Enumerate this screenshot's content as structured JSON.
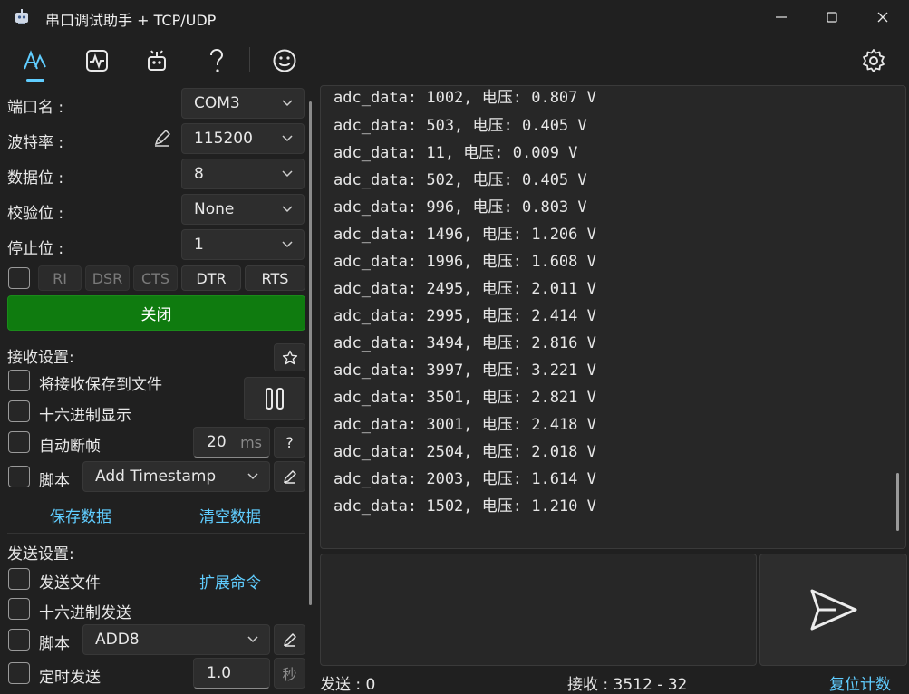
{
  "window": {
    "title": "串口调试助手 + TCP/UDP"
  },
  "toolbar": {
    "icons": [
      "waveform-text-icon",
      "pulse-chart-icon",
      "robot-icon",
      "help-icon",
      "smiley-icon",
      "settings-gear-icon"
    ]
  },
  "serial": {
    "port_label": "端口名 :",
    "port_value": "COM3",
    "baud_label": "波特率 :",
    "baud_value": "115200",
    "databits_label": "数据位 :",
    "databits_value": "8",
    "parity_label": "校验位 :",
    "parity_value": "None",
    "stopbits_label": "停止位 :",
    "stopbits_value": "1",
    "pins": [
      "RI",
      "DSR",
      "CTS",
      "DTR",
      "RTS"
    ],
    "close_button": "关闭"
  },
  "receive": {
    "section_label": "接收设置:",
    "save_to_file": "将接收保存到文件",
    "hex_display": "十六进制显示",
    "auto_frame": "自动断帧",
    "auto_frame_value": "20",
    "auto_frame_unit": "ms",
    "help_label": "?",
    "script_label": "脚本",
    "script_value": "Add Timestamp",
    "save_data": "保存数据",
    "clear_data": "清空数据"
  },
  "send": {
    "section_label": "发送设置:",
    "send_file": "发送文件",
    "ext_commands": "扩展命令",
    "hex_send": "十六进制发送",
    "script_label": "脚本",
    "script_value": "ADD8",
    "timed_send": "定时发送",
    "timed_value": "1.0",
    "timed_unit": "秒"
  },
  "log": {
    "lines": [
      "adc_data: 1002, 电压: 0.807 V",
      "adc_data: 503, 电压: 0.405 V",
      "adc_data: 11, 电压: 0.009 V",
      "adc_data: 502, 电压: 0.405 V",
      "adc_data: 996, 电压: 0.803 V",
      "adc_data: 1496, 电压: 1.206 V",
      "adc_data: 1996, 电压: 1.608 V",
      "adc_data: 2495, 电压: 2.011 V",
      "adc_data: 2995, 电压: 2.414 V",
      "adc_data: 3494, 电压: 2.816 V",
      "adc_data: 3997, 电压: 3.221 V",
      "adc_data: 3501, 电压: 2.821 V",
      "adc_data: 3001, 电压: 2.418 V",
      "adc_data: 2504, 电压: 2.018 V",
      "adc_data: 2003, 电压: 1.614 V",
      "adc_data: 1502, 电压: 1.210 V"
    ]
  },
  "status": {
    "sent_label": "发送 : 0",
    "recv_label": "接收 : 3512  -  32",
    "reset_counter": "复位计数"
  },
  "colors": {
    "accent": "#60cdff",
    "close_button": "#0f7b0f",
    "background": "#202020"
  }
}
